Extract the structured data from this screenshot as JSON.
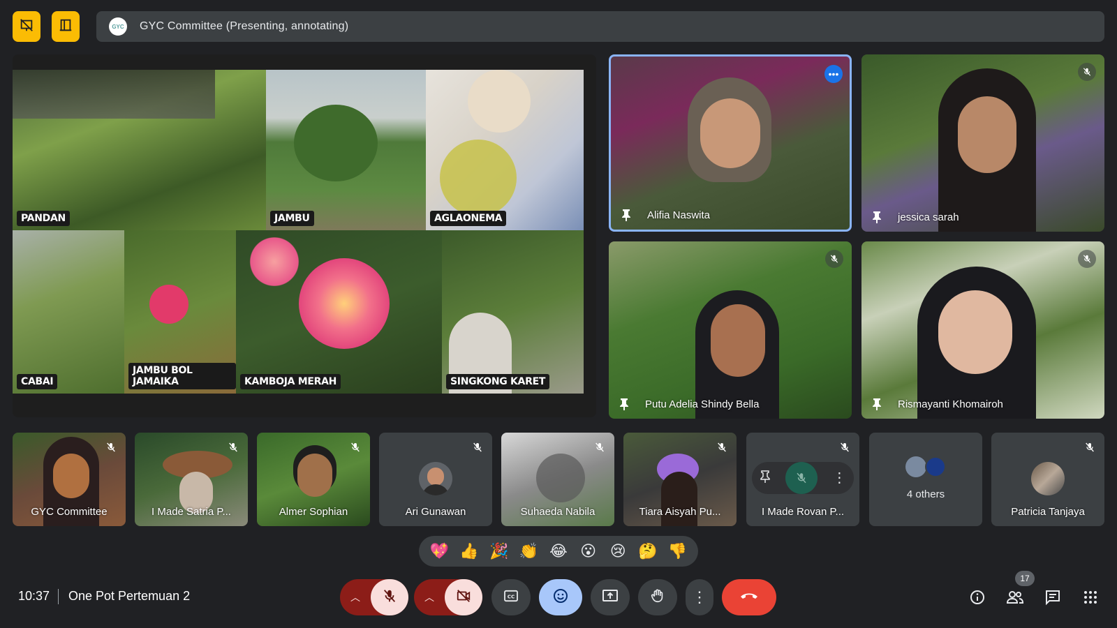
{
  "top_bar": {
    "presenter_logo": "GYC",
    "presenting_text": "GYC Committee (Presenting, annotating)"
  },
  "shared_screen": {
    "photos": [
      {
        "label": "PANDAN"
      },
      {
        "label": "JAMBU"
      },
      {
        "label": "AGLAONEMA"
      },
      {
        "label": "CABAI"
      },
      {
        "label": "JAMBU BOL JAMAIKA"
      },
      {
        "label": "KAMBOJA MERAH"
      },
      {
        "label": "SINGKONG KARET"
      }
    ]
  },
  "main_tiles": [
    {
      "name": "Alifia Naswita",
      "active_speaker": true
    },
    {
      "name": "jessica sarah"
    },
    {
      "name": "Putu Adelia Shindy Bella"
    },
    {
      "name": "Rismayanti Khomairoh"
    }
  ],
  "filmstrip": [
    {
      "name": "GYC Committee"
    },
    {
      "name": "I Made Satria P..."
    },
    {
      "name": "Almer Sophian"
    },
    {
      "name": "Ari Gunawan"
    },
    {
      "name": "Suhaeda Nabila"
    },
    {
      "name": "Tiara Aisyah Pu..."
    },
    {
      "name": "I Made Rovan P..."
    },
    {
      "name": "4 others"
    },
    {
      "name": "Patricia Tanjaya"
    }
  ],
  "reactions": [
    "💖",
    "👍",
    "🎉",
    "👏",
    "😂",
    "😮",
    "😢",
    "🤔",
    "👎"
  ],
  "bottom_bar": {
    "time": "10:37",
    "meeting_title": "One Pot Pertemuan 2",
    "participant_count": "17"
  },
  "colors": {
    "background": "#202124",
    "accent_yellow": "#fbbc04",
    "active_border": "#8ab4f8",
    "end_call": "#ea4335",
    "muted_button": "#f9dedc"
  }
}
